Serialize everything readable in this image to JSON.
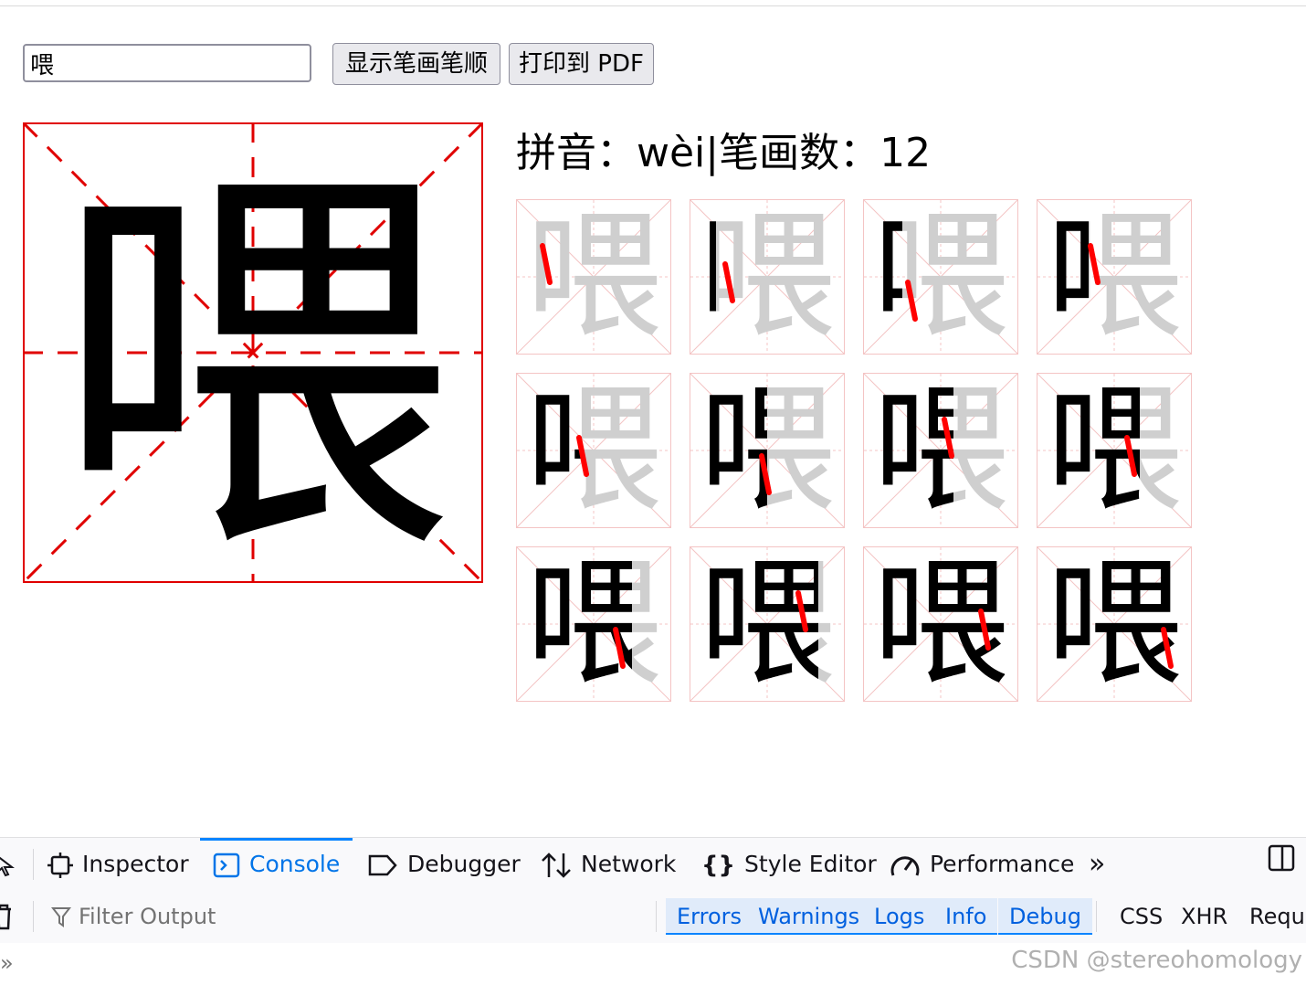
{
  "toolbar": {
    "input_value": "喂",
    "show_strokes_button": "显示笔画笔顺",
    "print_pdf_button": "打印到 PDF"
  },
  "character": {
    "glyph": "喂",
    "info_line": "拼音：wèi|笔画数：12",
    "stroke_count": 12
  },
  "colors": {
    "grid_red": "#e00000",
    "stroke_highlight": "#ff0000",
    "pending_gray": "#cfcfcf",
    "devtools_accent": "#0074e8"
  },
  "devtools": {
    "tabs": [
      {
        "label": "Inspector",
        "icon": "inspector-icon"
      },
      {
        "label": "Console",
        "icon": "console-icon",
        "active": true
      },
      {
        "label": "Debugger",
        "icon": "debugger-icon"
      },
      {
        "label": "Network",
        "icon": "network-icon"
      },
      {
        "label": "Style Editor",
        "icon": "style-editor-icon"
      },
      {
        "label": "Performance",
        "icon": "performance-icon"
      }
    ],
    "filter_placeholder": "Filter Output",
    "levels": [
      "Errors",
      "Warnings",
      "Logs",
      "Info",
      "Debug"
    ],
    "types": [
      "CSS",
      "XHR",
      "Reque"
    ],
    "watermark": "CSDN @stereohomology"
  }
}
